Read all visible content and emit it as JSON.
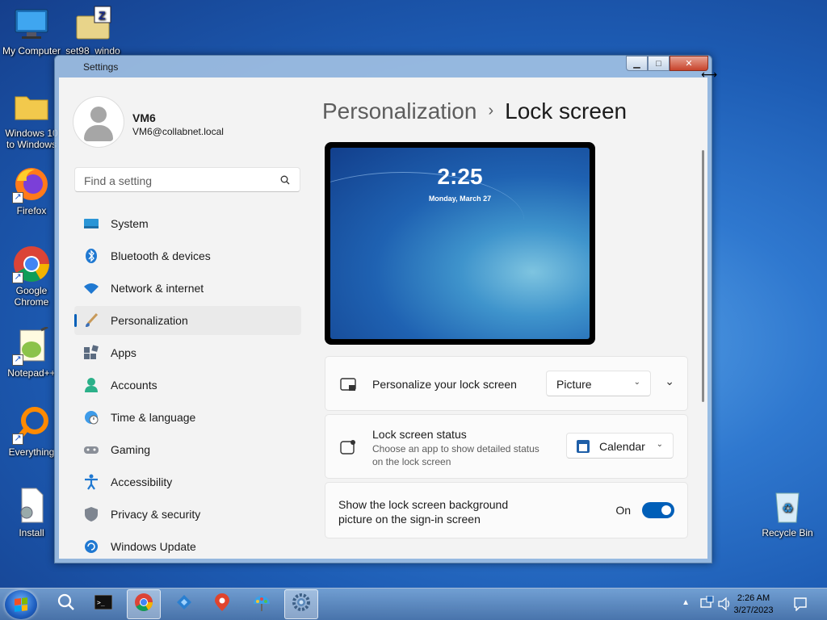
{
  "desktop": {
    "icons": [
      {
        "label": "My Computer",
        "icon": "computer-icon"
      },
      {
        "label": "set98_windo",
        "icon": "zip-folder-icon"
      },
      {
        "label": "Windows 10\nto Windows",
        "icon": "folder-icon"
      },
      {
        "label": "Firefox",
        "icon": "firefox-icon"
      },
      {
        "label": "Google\nChrome",
        "icon": "chrome-icon"
      },
      {
        "label": "Notepad++",
        "icon": "notepadpp-icon"
      },
      {
        "label": "Everything",
        "icon": "everything-icon"
      },
      {
        "label": "Install",
        "icon": "install-icon"
      },
      {
        "label": "Recycle Bin",
        "icon": "recycle-bin-icon"
      }
    ]
  },
  "window": {
    "title": "Settings",
    "buttons": {
      "minimize": "minimize",
      "maximize": "maximize",
      "close": "close"
    }
  },
  "user": {
    "name": "VM6",
    "email": "VM6@collabnet.local"
  },
  "search": {
    "placeholder": "Find a setting"
  },
  "nav": [
    {
      "label": "System",
      "icon": "system-icon"
    },
    {
      "label": "Bluetooth & devices",
      "icon": "bluetooth-icon"
    },
    {
      "label": "Network & internet",
      "icon": "wifi-icon"
    },
    {
      "label": "Personalization",
      "icon": "brush-icon",
      "active": true
    },
    {
      "label": "Apps",
      "icon": "apps-icon"
    },
    {
      "label": "Accounts",
      "icon": "accounts-icon"
    },
    {
      "label": "Time & language",
      "icon": "time-language-icon"
    },
    {
      "label": "Gaming",
      "icon": "gaming-icon"
    },
    {
      "label": "Accessibility",
      "icon": "accessibility-icon"
    },
    {
      "label": "Privacy & security",
      "icon": "shield-icon"
    },
    {
      "label": "Windows Update",
      "icon": "update-icon"
    }
  ],
  "main": {
    "breadcrumb_parent": "Personalization",
    "breadcrumb_sep": "›",
    "breadcrumb_current": "Lock screen",
    "preview": {
      "time": "2:25",
      "date": "Monday, March 27"
    },
    "personalize": {
      "label": "Personalize your lock screen",
      "value": "Picture"
    },
    "status": {
      "label": "Lock screen status",
      "description": "Choose an app to show detailed status on the lock screen",
      "value": "Calendar"
    },
    "signin": {
      "label": "Show the lock screen background picture on the sign-in screen",
      "state": "On",
      "enabled": true
    }
  },
  "taskbar": {
    "apps": [
      "start-button",
      "search-icon",
      "terminal-icon",
      "chrome-icon",
      "app-icon",
      "maps-icon",
      "paint-icon",
      "settings-icon"
    ],
    "clock_time": "2:26 AM",
    "clock_date": "3/27/2023",
    "accent": "#005fb8"
  }
}
